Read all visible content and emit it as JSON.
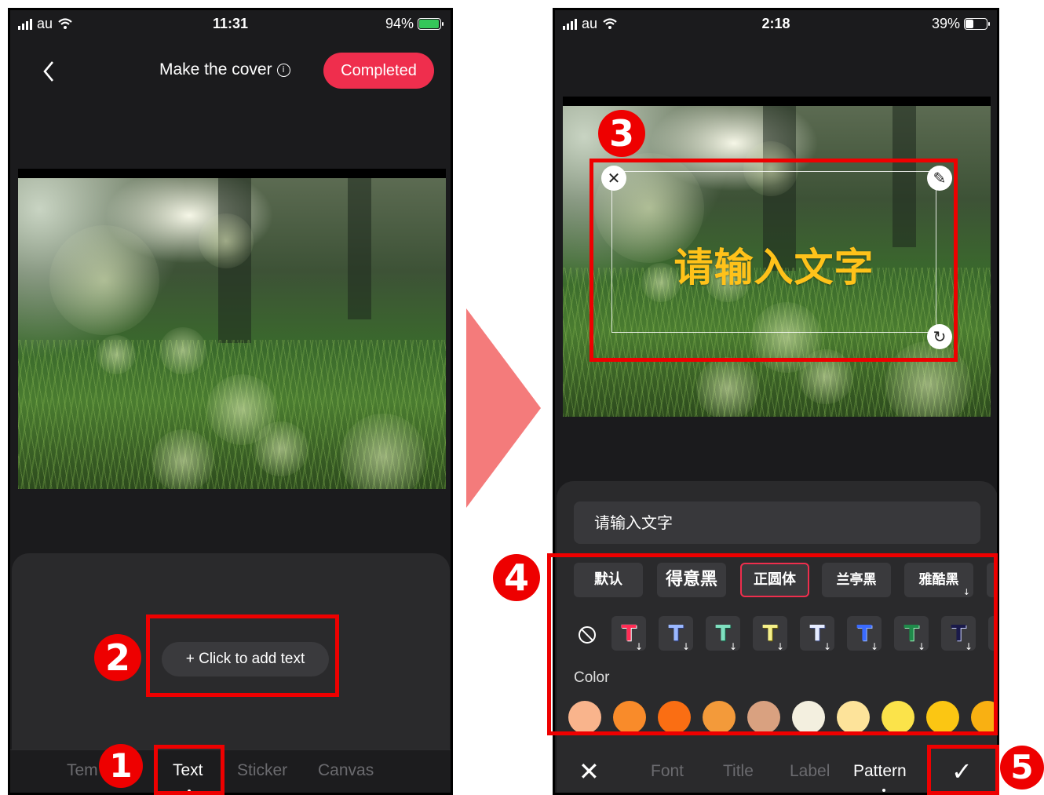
{
  "left_screen": {
    "status": {
      "carrier": "au",
      "time": "11:31",
      "battery": "94%"
    },
    "header": {
      "title": "Make the cover",
      "info_icon": "info-icon",
      "completed_label": "Completed"
    },
    "add_text_label": "+ Click to add text",
    "tabs": [
      {
        "label": "Template",
        "visible_text": "Tem"
      },
      {
        "label": "Text",
        "active": true
      },
      {
        "label": "Sticker"
      },
      {
        "label": "Canvas"
      }
    ]
  },
  "right_screen": {
    "status": {
      "carrier": "au",
      "time": "2:18",
      "battery": "39%"
    },
    "overlay_text": "请输入文字",
    "text_input_value": "请输入文字",
    "fonts": [
      "默认",
      "得意黑",
      "正圆体",
      "兰亭黑",
      "雅酷黑"
    ],
    "selected_font": "正圆体",
    "text_styles": [
      {
        "glyph": "T",
        "color": "#ff2d55"
      },
      {
        "glyph": "T",
        "color": "#9ab8ff"
      },
      {
        "glyph": "T",
        "color": "#7fe0c0"
      },
      {
        "glyph": "T",
        "color": "#f5f08a"
      },
      {
        "glyph": "T",
        "color": "#c8d8ff"
      },
      {
        "glyph": "T",
        "color": "#3a6bff"
      },
      {
        "glyph": "T",
        "color": "#1f8a4a"
      },
      {
        "glyph": "T",
        "color": "#1a1a4a"
      }
    ],
    "color_label": "Color",
    "swatches": [
      "#f9b48c",
      "#f98b2a",
      "#fa6e13",
      "#f39a3a",
      "#d9a180",
      "#f3efdf",
      "#fde39a",
      "#fbe34a",
      "#fbc613",
      "#f9b012"
    ],
    "bottom_tabs": [
      "Font",
      "Title",
      "Label",
      "Pattern"
    ],
    "active_bottom_tab": "Pattern"
  },
  "markers": [
    "1",
    "2",
    "3",
    "4",
    "5"
  ],
  "colors": {
    "accent": "#ef2e4d",
    "highlight": "#ee0000",
    "arrow": "#f47b7b",
    "text_yellow": "#ffc21a"
  }
}
